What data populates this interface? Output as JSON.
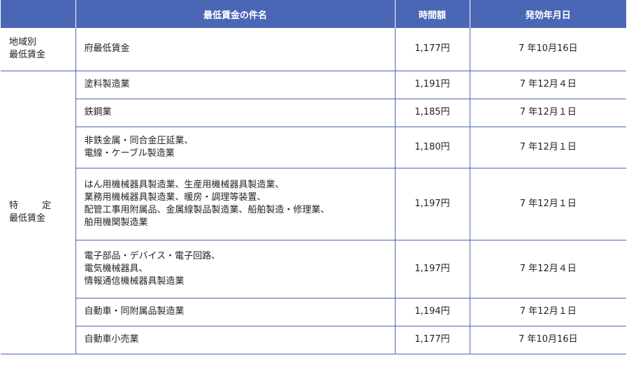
{
  "header": {
    "category": "",
    "name": "最低賃金の件名",
    "wage": "時間額",
    "date": "発効年月日"
  },
  "groups": {
    "regional": {
      "line1": "地域別",
      "line2": "最低賃金"
    },
    "specific": {
      "line1a": "特",
      "line1b": "定",
      "line2": "最低賃金"
    }
  },
  "rows": [
    {
      "name": [
        "府最低賃金"
      ],
      "wage": "1,177円",
      "date": "7 年10月16日"
    },
    {
      "name": [
        "塗料製造業"
      ],
      "wage": "1,191円",
      "date": "7 年12月４日"
    },
    {
      "name": [
        "鉄鋼業"
      ],
      "wage": "1,185円",
      "date": "7 年12月１日"
    },
    {
      "name": [
        "非鉄金属・同合金圧延業、",
        "電線・ケーブル製造業"
      ],
      "wage": "1,180円",
      "date": "7 年12月１日"
    },
    {
      "name": [
        "はん用機械器具製造業、生産用機械器具製造業、",
        "業務用機械器具製造業、暖房・調理等装置、",
        "配管工事用附属品、金属線製品製造業、船舶製造・修理業、",
        "舶用機関製造業"
      ],
      "wage": "1,197円",
      "date": "7 年12月１日"
    },
    {
      "name": [
        "電子部品・デバイス・電子回路、",
        "電気機械器具、",
        "情報通信機械器具製造業"
      ],
      "wage": "1,197円",
      "date": "7 年12月４日"
    },
    {
      "name": [
        "自動車・同附属品製造業"
      ],
      "wage": "1,194円",
      "date": "7 年12月１日"
    },
    {
      "name": [
        "自動車小売業"
      ],
      "wage": "1,177円",
      "date": "7 年10月16日"
    }
  ]
}
